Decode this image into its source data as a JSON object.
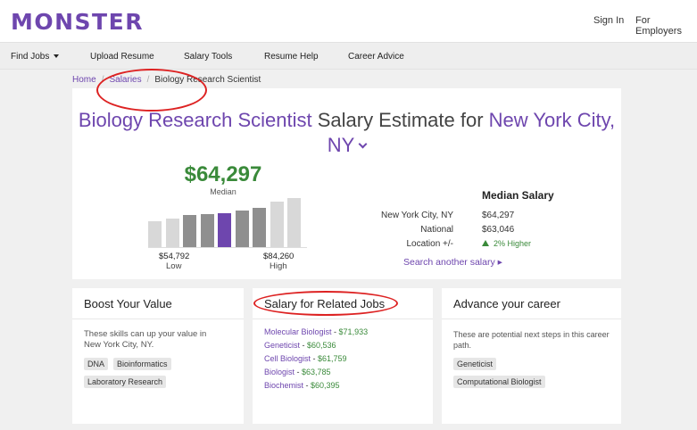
{
  "header": {
    "logo": "MONSTER",
    "sign_in": "Sign In",
    "for_employers": "For Employers"
  },
  "nav": {
    "items": [
      "Find Jobs",
      "Upload Resume",
      "Salary Tools",
      "Resume Help",
      "Career Advice"
    ]
  },
  "breadcrumb": {
    "home": "Home",
    "salaries": "Salaries",
    "current": "Biology Research Scientist",
    "sep": "/"
  },
  "main": {
    "title_job": "Biology Research Scientist",
    "title_mid": " Salary Estimate for ",
    "title_loc": "New York City, NY",
    "median_value": "$64,297",
    "median_label": "Median",
    "low_value": "$54,792",
    "low_label": "Low",
    "high_value": "$84,260",
    "high_label": "High",
    "histogram": {
      "bar_levels": [
        0.5,
        0.56,
        0.62,
        0.64,
        0.66,
        0.7,
        0.76,
        0.88,
        0.94
      ],
      "bar_colors": [
        "#d8d8d8",
        "#d8d8d8",
        "#8f8f8f",
        "#8f8f8f",
        "#6e46ae",
        "#8f8f8f",
        "#8f8f8f",
        "#d8d8d8",
        "#d8d8d8"
      ]
    },
    "median_salary_title": "Median Salary",
    "rows": [
      {
        "label": "New York City, NY",
        "value": "$64,297"
      },
      {
        "label": "National",
        "value": "$63,046"
      },
      {
        "label": "Location +/-",
        "value": "2% Higher"
      }
    ],
    "search_another": "Search another salary ▸"
  },
  "boost": {
    "title": "Boost Your Value",
    "text_line1": "These skills can up your value in",
    "text_line2": "New York City, NY.",
    "tags": [
      "DNA",
      "Bioinformatics",
      "Laboratory Research"
    ]
  },
  "related": {
    "title": "Salary for Related Jobs",
    "items": [
      {
        "job": "Molecular Biologist",
        "salary": "$71,933"
      },
      {
        "job": "Geneticist",
        "salary": "$60,536"
      },
      {
        "job": "Cell Biologist",
        "salary": "$61,759"
      },
      {
        "job": "Biologist",
        "salary": "$63,785"
      },
      {
        "job": "Biochemist",
        "salary": "$60,395"
      }
    ]
  },
  "advance": {
    "title": "Advance your career",
    "text_line1": "These are potential next steps in this career",
    "text_line2": "path.",
    "tags": [
      "Geneticist",
      "Computational Biologist"
    ]
  },
  "colors": {
    "brand_purple": "#6e46ae",
    "salary_green": "#3a8a3a",
    "annotation_red": "#d22"
  }
}
